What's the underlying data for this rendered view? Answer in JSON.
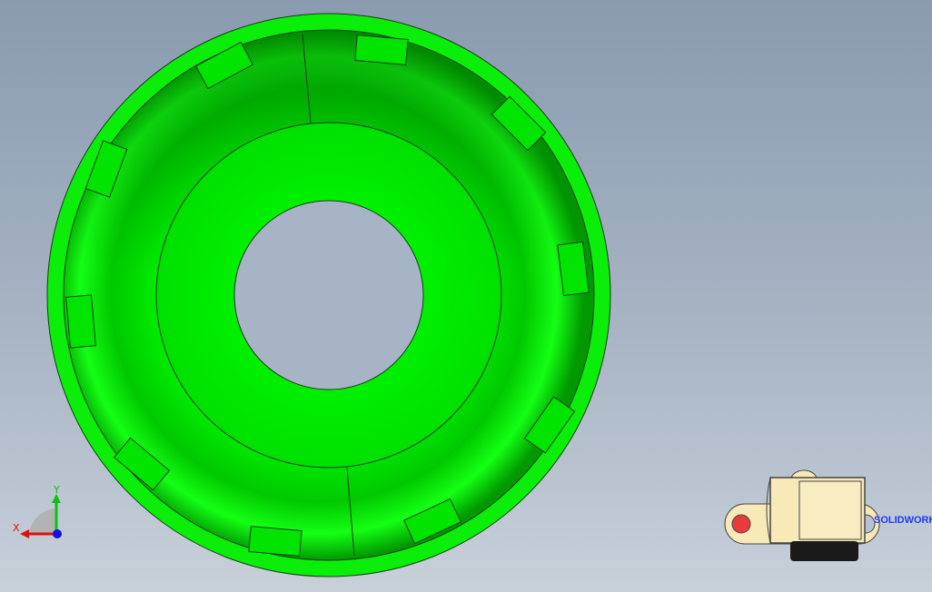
{
  "viewport": {
    "background_top": "#8a9bb0",
    "background_bottom": "#c8d0da",
    "model_color": "#00ff00",
    "model_shade": "#00a800"
  },
  "triad": {
    "x_label": "X",
    "y_label": "Y",
    "x_color": "#e01010",
    "y_color": "#10c010",
    "z_color": "#1010e0"
  },
  "mini_part": {
    "tag_text": "SOLIDWORKS",
    "body_color": "#f7eab8",
    "marker_color": "#e83c3c"
  },
  "icons": [
    "coordinate-triad-icon",
    "part-thumbnail-icon"
  ]
}
